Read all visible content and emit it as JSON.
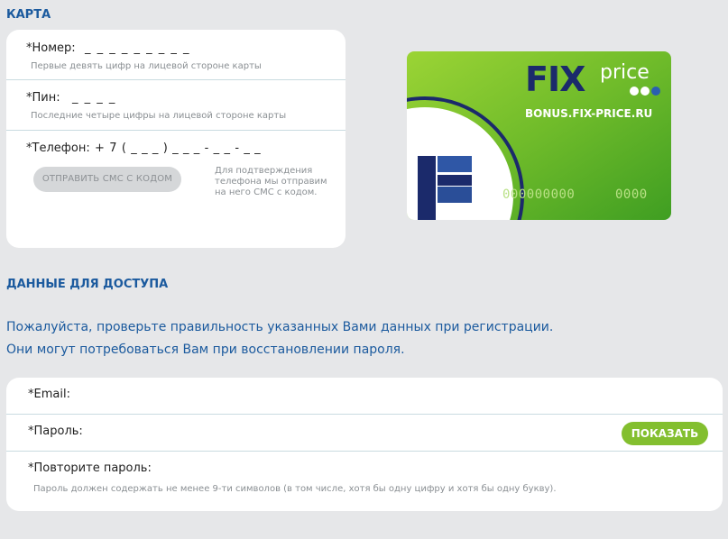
{
  "card_section": {
    "title": "КАРТА",
    "number": {
      "label": "*Номер:",
      "mask": "_ _ _ _ _ _ _ _ _",
      "hint": "Первые девять цифр на лицевой стороне карты"
    },
    "pin": {
      "label": "*Пин:",
      "mask": "_ _ _ _",
      "hint": "Последние четыре цифры на лицевой стороне карты"
    },
    "phone": {
      "label": "*Телефон:",
      "mask": "+ 7 ( _ _ _ ) _ _ _ - _ _ - _ _"
    },
    "sms_button": "ОТПРАВИТЬ СМС С КОДОМ",
    "sms_note": "Для подтверждения телефона мы отправим на него СМС с кодом."
  },
  "card_image": {
    "brand_fix": "FIX",
    "brand_price": "price",
    "site": "BONUS.FIX-PRICE.RU",
    "digits_main": "000000000",
    "digits_pin": "0000",
    "colors": {
      "green_light": "#8ccc2e",
      "green_dark": "#3a9a22",
      "navy": "#1b2a6b",
      "dots": "#2a5fb0"
    }
  },
  "access_section": {
    "title": "ДАННЫЕ ДЛЯ ДОСТУПА",
    "info_line1": "Пожалуйста, проверьте правильность указанных Вами данных при регистрации.",
    "info_line2": "Они могут потребоваться Вам при восстановлении пароля.",
    "email_label": "*Email:",
    "password_label": "*Пароль:",
    "show_button": "ПОКАЗАТЬ",
    "repeat_label": "*Повторите пароль:",
    "password_hint": "Пароль должен содержать не менее 9-ти символов (в том числе, хотя бы одну цифру и хотя бы одну букву)."
  },
  "colors": {
    "accent_blue": "#1b5a9e",
    "accent_green": "#83bf2f",
    "background": "#e6e7e9"
  }
}
